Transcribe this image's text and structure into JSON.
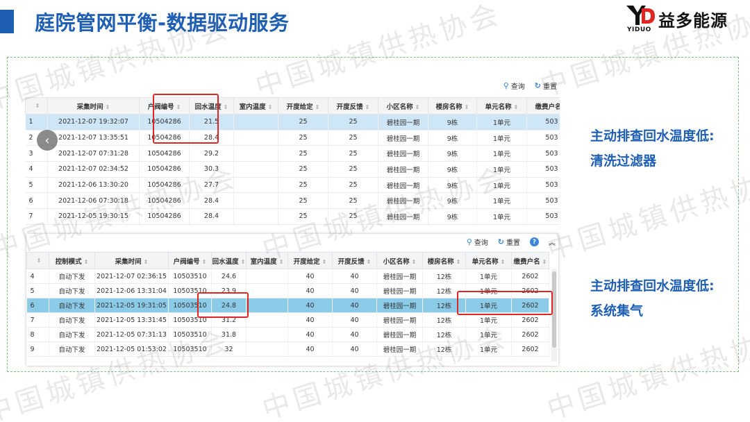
{
  "page": {
    "title": "庭院管网平衡-数据驱动服务",
    "logo_mark": "YD",
    "logo_sub": "YIDUO",
    "logo_text": "益多能源",
    "accent_color": "#1f5fb3",
    "watermark": "中国城镇供热协会"
  },
  "table1": {
    "toolbar": {
      "query": "查询",
      "reset": "重置",
      "query_icon": "search-icon",
      "reset_icon": "refresh-icon"
    },
    "headers": [
      "",
      "采集时间",
      "户阀编号",
      "回水温度",
      "室内温度",
      "开度给定",
      "开度反馈",
      "小区名称",
      "楼房名称",
      "单元名称",
      "缴费户名"
    ],
    "rows": [
      [
        "1",
        "2021-12-07 19:32:07",
        "10504286",
        "21.5",
        "",
        "25",
        "25",
        "碧桂园一期",
        "9栋",
        "1单元",
        "503"
      ],
      [
        "2",
        "2021-12-07 13:35:51",
        "10504286",
        "28.4",
        "",
        "25",
        "25",
        "碧桂园一期",
        "9栋",
        "1单元",
        "503"
      ],
      [
        "3",
        "2021-12-07 07:31:28",
        "10504286",
        "29.2",
        "",
        "25",
        "25",
        "碧桂园一期",
        "9栋",
        "1单元",
        "503"
      ],
      [
        "4",
        "2021-12-07 02:34:52",
        "10504286",
        "30.3",
        "",
        "25",
        "25",
        "碧桂园一期",
        "9栋",
        "1单元",
        "503"
      ],
      [
        "5",
        "2021-12-06 13:30:20",
        "10504286",
        "27.7",
        "",
        "25",
        "25",
        "碧桂园一期",
        "9栋",
        "1单元",
        "503"
      ],
      [
        "6",
        "2021-12-06 07:30:18",
        "10504286",
        "28.4",
        "",
        "25",
        "25",
        "碧桂园一期",
        "9栋",
        "1单元",
        "503"
      ],
      [
        "7",
        "2021-12-05 19:30:15",
        "10504286",
        "28.4",
        "",
        "25",
        "25",
        "碧桂园一期",
        "9栋",
        "1单元",
        "503"
      ]
    ]
  },
  "table2": {
    "toolbar": {
      "query": "查询",
      "reset": "重置",
      "help": "?",
      "collapse": "︽"
    },
    "headers": [
      "",
      "控制模式",
      "采集时间",
      "户阀编号",
      "回水温度",
      "室内温度",
      "开度给定",
      "开度反馈",
      "小区名称",
      "楼房名称",
      "单元名称",
      "缴费户名"
    ],
    "rows": [
      [
        "4",
        "自动下发",
        "2021-12-07 02:36:15",
        "10503510",
        "24.6",
        "",
        "40",
        "40",
        "碧桂园一期",
        "12栋",
        "1单元",
        "2602"
      ],
      [
        "5",
        "自动下发",
        "2021-12-06 13:31:04",
        "10503510",
        "23.9",
        "",
        "40",
        "40",
        "碧桂园一期",
        "12栋",
        "1单元",
        "2602"
      ],
      [
        "6",
        "自动下发",
        "2021-12-05 19:31:05",
        "10503510",
        "24.8",
        "",
        "40",
        "40",
        "碧桂园一期",
        "12栋",
        "1单元",
        "2602"
      ],
      [
        "7",
        "自动下发",
        "2021-12-05 13:31:45",
        "10503510",
        "31.2",
        "",
        "40",
        "40",
        "碧桂园一期",
        "12栋",
        "1单元",
        "2602"
      ],
      [
        "8",
        "自动下发",
        "2021-12-05 07:31:13",
        "10503510",
        "31.8",
        "",
        "40",
        "40",
        "碧桂园一期",
        "12栋",
        "1单元",
        "2602"
      ],
      [
        "9",
        "自动下发",
        "2021-12-05 01:53:02",
        "10503510",
        "32",
        "",
        "40",
        "40",
        "碧桂园一期",
        "12栋",
        "1单元",
        "2602"
      ]
    ]
  },
  "notes": {
    "note1_line1": "主动排查回水温度低:",
    "note1_line2": "清洗过滤器",
    "note2_line1": "主动排查回水温度低:",
    "note2_line2": "系统集气"
  },
  "nav": {
    "prev_icon": "‹"
  }
}
